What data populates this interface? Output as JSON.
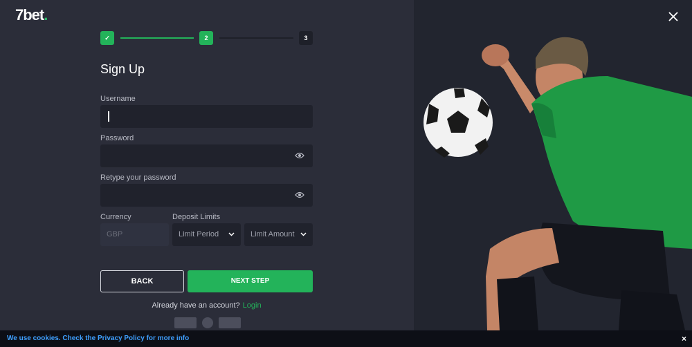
{
  "brand": {
    "logo_text": "7bet",
    "logo_dot": ".",
    "accent": "#23b35a"
  },
  "steps": [
    {
      "label": "✓",
      "state": "done"
    },
    {
      "label": "2",
      "state": "active"
    },
    {
      "label": "3",
      "state": "pending"
    }
  ],
  "form": {
    "title": "Sign Up",
    "username": {
      "label": "Username",
      "value": ""
    },
    "password": {
      "label": "Password",
      "value": ""
    },
    "retype": {
      "label": "Retype your password",
      "value": ""
    },
    "currency": {
      "label": "Currency",
      "value": "GBP"
    },
    "deposit": {
      "label": "Deposit Limits",
      "period_placeholder": "Limit Period",
      "amount_placeholder": "Limit Amount"
    },
    "back_label": "BACK",
    "next_label": "NEXT STEP",
    "already_text": "Already have an account?",
    "login_label": "Login"
  },
  "cookie": {
    "text": "We use cookies. Check the Privacy Policy for more info",
    "close": "×"
  },
  "icons": {
    "eye": "eye-icon",
    "close": "close-icon",
    "chevron": "chevron-down-icon",
    "check": "check-icon"
  }
}
